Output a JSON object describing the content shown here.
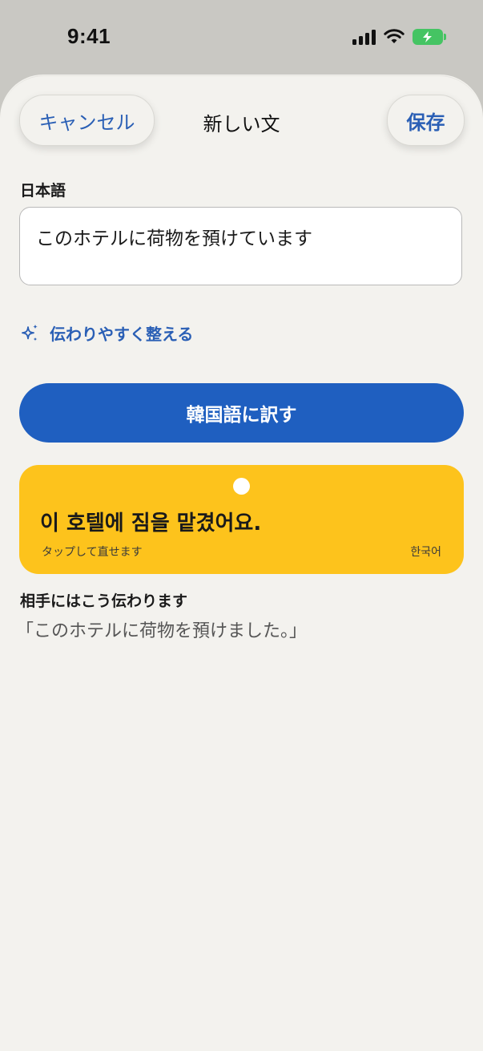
{
  "status_bar": {
    "time": "9:41",
    "icons": [
      "cellular-signal-icon",
      "wifi-icon",
      "battery-charging-icon"
    ],
    "battery_color": "#45c463"
  },
  "header": {
    "cancel_label": "キャンセル",
    "title": "新しい文",
    "save_label": "保存"
  },
  "source": {
    "label": "日本語",
    "value": "このホテルに荷物を預けています"
  },
  "improve": {
    "icon": "sparkle-icon",
    "label": "伝わりやすく整える"
  },
  "translate_button": {
    "label": "韓国語に訳す",
    "color": "#1f5fc0"
  },
  "result": {
    "text": "이 호텔에 짐을 맡겼어요.",
    "hint": "タップして直せます",
    "language": "한국어",
    "card_color": "#fdc31c"
  },
  "back_translation": {
    "label": "相手にはこう伝わります",
    "text": "「このホテルに荷物を預けました。」"
  },
  "colors": {
    "accent": "#2a5fb5",
    "sheet_background": "#f3f2ee",
    "backdrop": "#c9c8c3"
  }
}
